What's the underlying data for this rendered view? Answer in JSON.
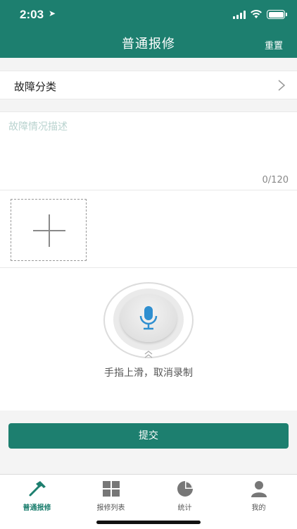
{
  "status_bar": {
    "time": "2:03"
  },
  "nav": {
    "title": "普通报修",
    "reset_label": "重置"
  },
  "category": {
    "label": "故障分类"
  },
  "description": {
    "placeholder": "故障情况描述",
    "value": "",
    "counter": "0/120"
  },
  "voice": {
    "hint": "手指上滑，取消录制"
  },
  "submit": {
    "label": "提交"
  },
  "tabs": [
    {
      "label": "普通报修",
      "icon": "hammer-icon",
      "active": true
    },
    {
      "label": "报修列表",
      "icon": "grid-icon",
      "active": false
    },
    {
      "label": "统计",
      "icon": "pie-chart-icon",
      "active": false
    },
    {
      "label": "我的",
      "icon": "user-icon",
      "active": false
    }
  ],
  "colors": {
    "primary": "#1d7f6f",
    "mic": "#2f8fd0",
    "placeholder": "#b9d3cf"
  }
}
